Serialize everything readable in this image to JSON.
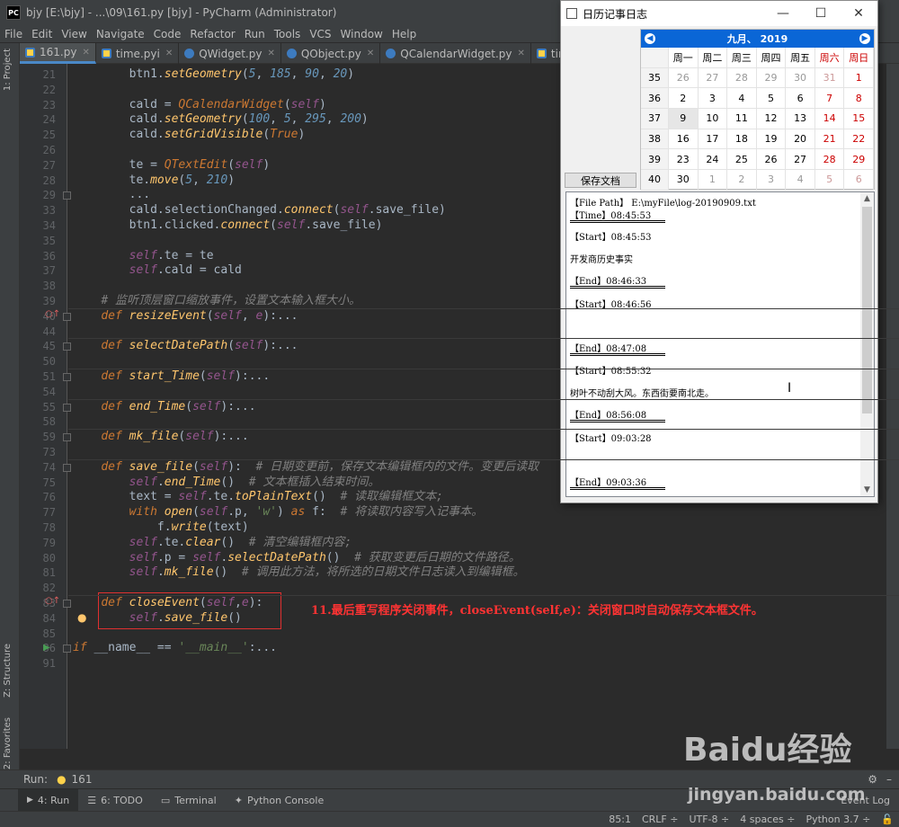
{
  "window": {
    "title": "bjy [E:\\bjy] - ...\\09\\161.py [bjy] - PyCharm (Administrator)",
    "logo": "PC"
  },
  "menu": [
    "File",
    "Edit",
    "View",
    "Navigate",
    "Code",
    "Refactor",
    "Run",
    "Tools",
    "VCS",
    "Window",
    "Help"
  ],
  "tabs": [
    {
      "label": "161.py",
      "active": true
    },
    {
      "label": "time.pyi",
      "active": false
    },
    {
      "label": "QWidget.py",
      "active": false
    },
    {
      "label": "QObject.py",
      "active": false
    },
    {
      "label": "QCalendarWidget.py",
      "active": false
    },
    {
      "label": "time.py",
      "active": false
    }
  ],
  "sidebar": {
    "project": "1: Project",
    "structure": "Z: Structure",
    "favorites": "2: Favorites"
  },
  "code_lines": [
    {
      "n": "21",
      "html": "        btn1.<span class=\"fn\">setGeometry</span>(<span class=\"num\">5</span>, <span class=\"num\">185</span>, <span class=\"num\">90</span>, <span class=\"num\">20</span>)"
    },
    {
      "n": "22",
      "html": ""
    },
    {
      "n": "23",
      "html": "        cald = <span class=\"kw\">QCalendarWidget</span>(<span class=\"sf\">self</span>)"
    },
    {
      "n": "24",
      "html": "        cald.<span class=\"fn\">setGeometry</span>(<span class=\"num\">100</span>, <span class=\"num\">5</span>, <span class=\"num\">295</span>, <span class=\"num\">200</span>)"
    },
    {
      "n": "25",
      "html": "        cald.<span class=\"fn\">setGridVisible</span>(<span class=\"kw\">True</span>)"
    },
    {
      "n": "26",
      "html": ""
    },
    {
      "n": "27",
      "html": "        te = <span class=\"kw\">QTextEdit</span>(<span class=\"sf\">self</span>)"
    },
    {
      "n": "28",
      "html": "        te.<span class=\"fn\">move</span>(<span class=\"num\">5</span>, <span class=\"num\">210</span>)"
    },
    {
      "n": "29",
      "html": "        ..."
    },
    {
      "n": "33",
      "html": "        cald.selectionChanged.<span class=\"fn\">connect</span>(<span class=\"sf\">self</span>.save_file)"
    },
    {
      "n": "34",
      "html": "        btn1.clicked.<span class=\"fn\">connect</span>(<span class=\"sf\">self</span>.save_file)"
    },
    {
      "n": "35",
      "html": ""
    },
    {
      "n": "36",
      "html": "        <span class=\"sf\">self</span>.te = te"
    },
    {
      "n": "37",
      "html": "        <span class=\"sf\">self</span>.cald = cald"
    },
    {
      "n": "38",
      "html": ""
    },
    {
      "n": "39",
      "html": "    <span class=\"cm\"># 监听顶层窗口缩放事件，设置文本输入框大小。</span>"
    },
    {
      "n": "40",
      "html": "    <span class=\"kw\">def</span> <span class=\"fn\">resizeEvent</span>(<span class=\"sf\">self</span>, <span class=\"sf\">e</span>):..."
    },
    {
      "n": "44",
      "html": ""
    },
    {
      "n": "45",
      "html": "    <span class=\"kw\">def</span> <span class=\"fn\">selectDatePath</span>(<span class=\"sf\">self</span>):..."
    },
    {
      "n": "50",
      "html": ""
    },
    {
      "n": "51",
      "html": "    <span class=\"kw\">def</span> <span class=\"fn\">start_Time</span>(<span class=\"sf\">self</span>):..."
    },
    {
      "n": "54",
      "html": ""
    },
    {
      "n": "55",
      "html": "    <span class=\"kw\">def</span> <span class=\"fn\">end_Time</span>(<span class=\"sf\">self</span>):..."
    },
    {
      "n": "58",
      "html": ""
    },
    {
      "n": "59",
      "html": "    <span class=\"kw\">def</span> <span class=\"fn\">mk_file</span>(<span class=\"sf\">self</span>):..."
    },
    {
      "n": "73",
      "html": ""
    },
    {
      "n": "74",
      "html": "    <span class=\"kw\">def</span> <span class=\"fn\">save_file</span>(<span class=\"sf\">self</span>):  <span class=\"cm\"># 日期变更前，保存文本编辑框内的文件。变更后读取</span>"
    },
    {
      "n": "75",
      "html": "        <span class=\"sf\">self</span>.<span class=\"fn\">end_Time</span>()  <span class=\"cm\"># 文本框插入结束时间。</span>"
    },
    {
      "n": "76",
      "html": "        text = <span class=\"sf\">self</span>.te.<span class=\"fn\">toPlainText</span>()  <span class=\"cm\"># 读取编辑框文本;</span>"
    },
    {
      "n": "77",
      "html": "        <span class=\"kw\">with</span> <span class=\"fn\">open</span>(<span class=\"sf\">self</span>.p, <span class=\"st\">'w'</span>) <span class=\"kw\">as</span> f:  <span class=\"cm\"># 将读取内容写入记事本。</span>"
    },
    {
      "n": "78",
      "html": "            f.<span class=\"fn\">write</span>(text)"
    },
    {
      "n": "79",
      "html": "        <span class=\"sf\">self</span>.te.<span class=\"fn\">clear</span>()  <span class=\"cm\"># 清空编辑框内容;</span>"
    },
    {
      "n": "80",
      "html": "        <span class=\"sf\">self</span>.p = <span class=\"sf\">self</span>.<span class=\"fn\">selectDatePath</span>()  <span class=\"cm\"># 获取变更后日期的文件路径。</span>"
    },
    {
      "n": "81",
      "html": "        <span class=\"sf\">self</span>.<span class=\"fn\">mk_file</span>()  <span class=\"cm\"># 调用此方法，将所选的日期文件日志读入到编辑框。</span>"
    },
    {
      "n": "82",
      "html": ""
    },
    {
      "n": "83",
      "html": "    <span class=\"kw\">def</span> <span class=\"fn\">closeEvent</span>(<span class=\"sf\">self</span>,<span class=\"sf\">e</span>):"
    },
    {
      "n": "84",
      "html": "        <span class=\"sf\">self</span>.<span class=\"fn\">save_file</span>()"
    },
    {
      "n": "85",
      "html": ""
    },
    {
      "n": "86",
      "html": "<span class=\"kw\">if</span> __name__ == <span class=\"st\">'__main__'</span>:..."
    },
    {
      "n": "91",
      "html": ""
    }
  ],
  "annotation": "11.最后重写程序关闭事件，closeEvent(self,e)：关闭窗口时自动保存文本框文件。",
  "dialog": {
    "title": "日历记事日志",
    "controls": [
      "—",
      "☐",
      "✕"
    ],
    "save_button": "保存文档",
    "calendar": {
      "month": "九月",
      "year": "2019",
      "weekdays": [
        "周一",
        "周二",
        "周三",
        "周四",
        "周五",
        "周六",
        "周日"
      ],
      "weeks": [
        {
          "wk": "35",
          "days": [
            "26",
            "27",
            "28",
            "29",
            "30",
            "31",
            "1"
          ]
        },
        {
          "wk": "36",
          "days": [
            "2",
            "3",
            "4",
            "5",
            "6",
            "7",
            "8"
          ]
        },
        {
          "wk": "37",
          "days": [
            "9",
            "10",
            "11",
            "12",
            "13",
            "14",
            "15"
          ]
        },
        {
          "wk": "38",
          "days": [
            "16",
            "17",
            "18",
            "19",
            "20",
            "21",
            "22"
          ]
        },
        {
          "wk": "39",
          "days": [
            "23",
            "24",
            "25",
            "26",
            "27",
            "28",
            "29"
          ]
        },
        {
          "wk": "40",
          "days": [
            "30",
            "1",
            "2",
            "3",
            "4",
            "5",
            "6"
          ]
        }
      ],
      "selected_day": "9"
    },
    "log": {
      "file_path": "【File Path】 E:\\myFile\\log-20190909.txt",
      "time": "【Time】08:45:53",
      "entries": [
        {
          "start": "【Start】08:45:53",
          "text": "开发商历史事实",
          "end": "【End】08:46:33"
        },
        {
          "start": "【Start】08:46:56",
          "text": "",
          "end": "【End】08:47:08"
        },
        {
          "start": "【Start】08:55:32",
          "text": "树叶不动刮大风。东西街要南北走。",
          "end": "【End】08:56:08"
        },
        {
          "start": "【Start】09:03:28",
          "text": "",
          "end": "【End】09:03:36"
        }
      ]
    }
  },
  "run": {
    "label": "Run:",
    "config": "161"
  },
  "bottom_tabs": [
    "4: Run",
    "6: TODO",
    "Terminal",
    "Python Console"
  ],
  "event_log": "Event Log",
  "status": {
    "position": "85:1",
    "line_sep": "CRLF ÷",
    "encoding": "UTF-8 ÷",
    "indent": "4 spaces ÷",
    "interpreter": "Python 3.7 ÷"
  },
  "watermark": {
    "brand": "Baidu经验",
    "url": "jingyan.baidu.com"
  }
}
